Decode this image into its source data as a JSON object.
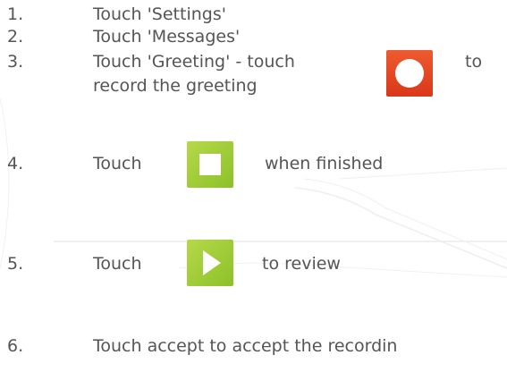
{
  "colors": {
    "text": "#555555",
    "record_red": "#e0462a",
    "action_green": "#a3cd3a"
  },
  "icons": {
    "record": "record-icon",
    "stop": "stop-icon",
    "play": "play-icon"
  },
  "steps": [
    {
      "number": "1.",
      "text": "Touch 'Settings'"
    },
    {
      "number": "2.",
      "text": "Touch 'Messages'"
    },
    {
      "number": "3.",
      "text_before": "Touch 'Greeting'  - touch",
      "text_after": "to",
      "text_line2": "record the greeting"
    },
    {
      "number": "4.",
      "text_before": "Touch",
      "text_after": "when finished"
    },
    {
      "number": "5.",
      "text_before": "Touch",
      "text_after": "to review"
    },
    {
      "number": "6.",
      "text": "Touch accept to accept the recordin"
    }
  ]
}
